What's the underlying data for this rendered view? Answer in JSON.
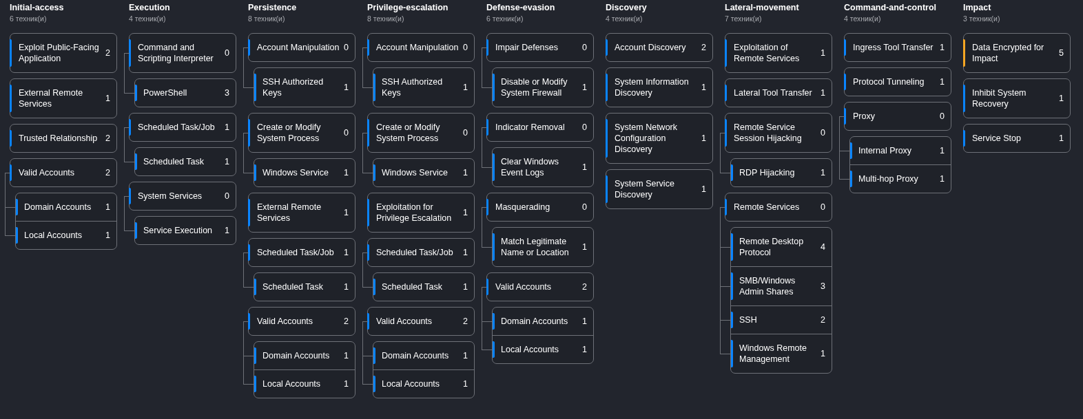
{
  "tactics": [
    {
      "name": "Initial-access",
      "count": "6 техник(и)",
      "techniques": [
        {
          "name": "Exploit Public-Facing Application",
          "count": "2",
          "color": "#0a84ff"
        },
        {
          "name": "External Remote Services",
          "count": "1",
          "color": "#0a84ff"
        },
        {
          "name": "Trusted Relationship",
          "count": "2",
          "color": "#0a84ff"
        },
        {
          "name": "Valid Accounts",
          "count": "2",
          "color": "#0a84ff",
          "children": [
            {
              "name": "Domain Accounts",
              "count": "1",
              "color": "#0a84ff"
            },
            {
              "name": "Local Accounts",
              "count": "1",
              "color": "#0a84ff"
            }
          ]
        }
      ]
    },
    {
      "name": "Execution",
      "count": "4 техник(и)",
      "techniques": [
        {
          "name": "Command and Scripting Interpreter",
          "count": "0",
          "color": "#0a84ff",
          "children": [
            {
              "name": "PowerShell",
              "count": "3",
              "color": "#0a84ff"
            }
          ]
        },
        {
          "name": "Scheduled Task/Job",
          "count": "1",
          "color": "#0a84ff",
          "children": [
            {
              "name": "Scheduled Task",
              "count": "1",
              "color": "#0a84ff"
            }
          ]
        },
        {
          "name": "System Services",
          "count": "0",
          "color": "#0a84ff",
          "children": [
            {
              "name": "Service Execution",
              "count": "1",
              "color": "#0a84ff"
            }
          ]
        }
      ]
    },
    {
      "name": "Persistence",
      "count": "8 техник(и)",
      "techniques": [
        {
          "name": "Account Manipulation",
          "count": "0",
          "color": "#0a84ff",
          "children": [
            {
              "name": "SSH Authorized Keys",
              "count": "1",
              "color": "#0a84ff"
            }
          ]
        },
        {
          "name": "Create or Modify System Process",
          "count": "0",
          "color": "#0a84ff",
          "children": [
            {
              "name": "Windows Service",
              "count": "1",
              "color": "#0a84ff"
            }
          ]
        },
        {
          "name": "External Remote Services",
          "count": "1",
          "color": "#0a84ff"
        },
        {
          "name": "Scheduled Task/Job",
          "count": "1",
          "color": "#0a84ff",
          "children": [
            {
              "name": "Scheduled Task",
              "count": "1",
              "color": "#0a84ff"
            }
          ]
        },
        {
          "name": "Valid Accounts",
          "count": "2",
          "color": "#0a84ff",
          "children": [
            {
              "name": "Domain Accounts",
              "count": "1",
              "color": "#0a84ff"
            },
            {
              "name": "Local Accounts",
              "count": "1",
              "color": "#0a84ff"
            }
          ]
        }
      ]
    },
    {
      "name": "Privilege-escalation",
      "count": "8 техник(и)",
      "techniques": [
        {
          "name": "Account Manipulation",
          "count": "0",
          "color": "#0a84ff",
          "children": [
            {
              "name": "SSH Authorized Keys",
              "count": "1",
              "color": "#0a84ff"
            }
          ]
        },
        {
          "name": "Create or Modify System Process",
          "count": "0",
          "color": "#0a84ff",
          "children": [
            {
              "name": "Windows Service",
              "count": "1",
              "color": "#0a84ff"
            }
          ]
        },
        {
          "name": "Exploitation for Privilege Escalation",
          "count": "1",
          "color": "#0a84ff"
        },
        {
          "name": "Scheduled Task/Job",
          "count": "1",
          "color": "#0a84ff",
          "children": [
            {
              "name": "Scheduled Task",
              "count": "1",
              "color": "#0a84ff"
            }
          ]
        },
        {
          "name": "Valid Accounts",
          "count": "2",
          "color": "#0a84ff",
          "children": [
            {
              "name": "Domain Accounts",
              "count": "1",
              "color": "#0a84ff"
            },
            {
              "name": "Local Accounts",
              "count": "1",
              "color": "#0a84ff"
            }
          ]
        }
      ]
    },
    {
      "name": "Defense-evasion",
      "count": "6 техник(и)",
      "techniques": [
        {
          "name": "Impair Defenses",
          "count": "0",
          "color": "#0a84ff",
          "children": [
            {
              "name": "Disable or Modify System Firewall",
              "count": "1",
              "color": "#0a84ff"
            }
          ]
        },
        {
          "name": "Indicator Removal",
          "count": "0",
          "color": "#0a84ff",
          "children": [
            {
              "name": "Clear Windows Event Logs",
              "count": "1",
              "color": "#0a84ff"
            }
          ]
        },
        {
          "name": "Masquerading",
          "count": "0",
          "color": "#0a84ff",
          "children": [
            {
              "name": "Match Legitimate Name or Location",
              "count": "1",
              "color": "#0a84ff"
            }
          ]
        },
        {
          "name": "Valid Accounts",
          "count": "2",
          "color": "#0a84ff",
          "children": [
            {
              "name": "Domain Accounts",
              "count": "1",
              "color": "#0a84ff"
            },
            {
              "name": "Local Accounts",
              "count": "1",
              "color": "#0a84ff"
            }
          ]
        }
      ]
    },
    {
      "name": "Discovery",
      "count": "4 техник(и)",
      "techniques": [
        {
          "name": "Account Discovery",
          "count": "2",
          "color": "#0a84ff"
        },
        {
          "name": "System Information Discovery",
          "count": "1",
          "color": "#0a84ff"
        },
        {
          "name": "System Network Configuration Discovery",
          "count": "1",
          "color": "#0a84ff"
        },
        {
          "name": "System Service Discovery",
          "count": "1",
          "color": "#0a84ff"
        }
      ]
    },
    {
      "name": "Lateral-movement",
      "count": "7 техник(и)",
      "techniques": [
        {
          "name": "Exploitation of Remote Services",
          "count": "1",
          "color": "#0a84ff"
        },
        {
          "name": "Lateral Tool Transfer",
          "count": "1",
          "color": "#0a84ff"
        },
        {
          "name": "Remote Service Session Hijacking",
          "count": "0",
          "color": "#0a84ff",
          "children": [
            {
              "name": "RDP Hijacking",
              "count": "1",
              "color": "#0a84ff"
            }
          ]
        },
        {
          "name": "Remote Services",
          "count": "0",
          "color": "#0a84ff",
          "children": [
            {
              "name": "Remote Desktop Protocol",
              "count": "4",
              "color": "#0a84ff"
            },
            {
              "name": "SMB/Windows Admin Shares",
              "count": "3",
              "color": "#0a84ff"
            },
            {
              "name": "SSH",
              "count": "2",
              "color": "#0a84ff"
            },
            {
              "name": "Windows Remote Management",
              "count": "1",
              "color": "#0a84ff"
            }
          ]
        }
      ]
    },
    {
      "name": "Command-and-control",
      "count": "4 техник(и)",
      "techniques": [
        {
          "name": "Ingress Tool Transfer",
          "count": "1",
          "color": "#0a84ff"
        },
        {
          "name": "Protocol Tunneling",
          "count": "1",
          "color": "#0a84ff"
        },
        {
          "name": "Proxy",
          "count": "0",
          "color": "#0a84ff",
          "children": [
            {
              "name": "Internal Proxy",
              "count": "1",
              "color": "#0a84ff"
            },
            {
              "name": "Multi-hop Proxy",
              "count": "1",
              "color": "#0a84ff"
            }
          ]
        }
      ]
    },
    {
      "name": "Impact",
      "count": "3 техник(и)",
      "techniques": [
        {
          "name": "Data Encrypted for Impact",
          "count": "5",
          "color": "#f5a623"
        },
        {
          "name": "Inhibit System Recovery",
          "count": "1",
          "color": "#0a84ff"
        },
        {
          "name": "Service Stop",
          "count": "1",
          "color": "#0a84ff"
        }
      ]
    }
  ]
}
